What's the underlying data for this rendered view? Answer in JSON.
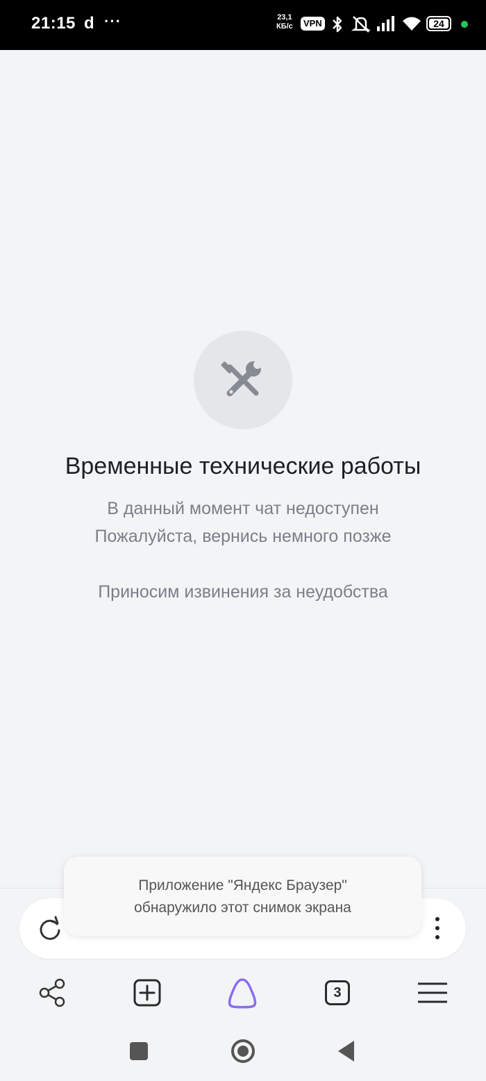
{
  "status_bar": {
    "time": "21:15",
    "notification_letter": "d",
    "more": "···",
    "speed_value": "23,1",
    "speed_unit": "КБ/с",
    "vpn": "VPN",
    "battery": "24",
    "icons": [
      "bluetooth-icon",
      "mute-alarm-icon",
      "signal-icon",
      "wifi-icon",
      "battery-icon"
    ]
  },
  "maintenance": {
    "icon": "tools-icon",
    "title": "Временные технические работы",
    "line1": "В данный момент чат недоступен",
    "line2": "Пожалуйста, вернись немного позже",
    "apology": "Приносим извинения за неудобства"
  },
  "toast": {
    "line1": "Приложение \"Яндекс Браузер\"",
    "line2": "обнаружило этот снимок экрана"
  },
  "toolbar": {
    "tab_count": "3",
    "items": [
      "share-icon",
      "new-tab-icon",
      "alice-icon",
      "tabs-icon",
      "menu-icon"
    ]
  },
  "colors": {
    "accent": "#8b6cf0",
    "background": "#f3f4f6",
    "status_bar": "#000000"
  }
}
